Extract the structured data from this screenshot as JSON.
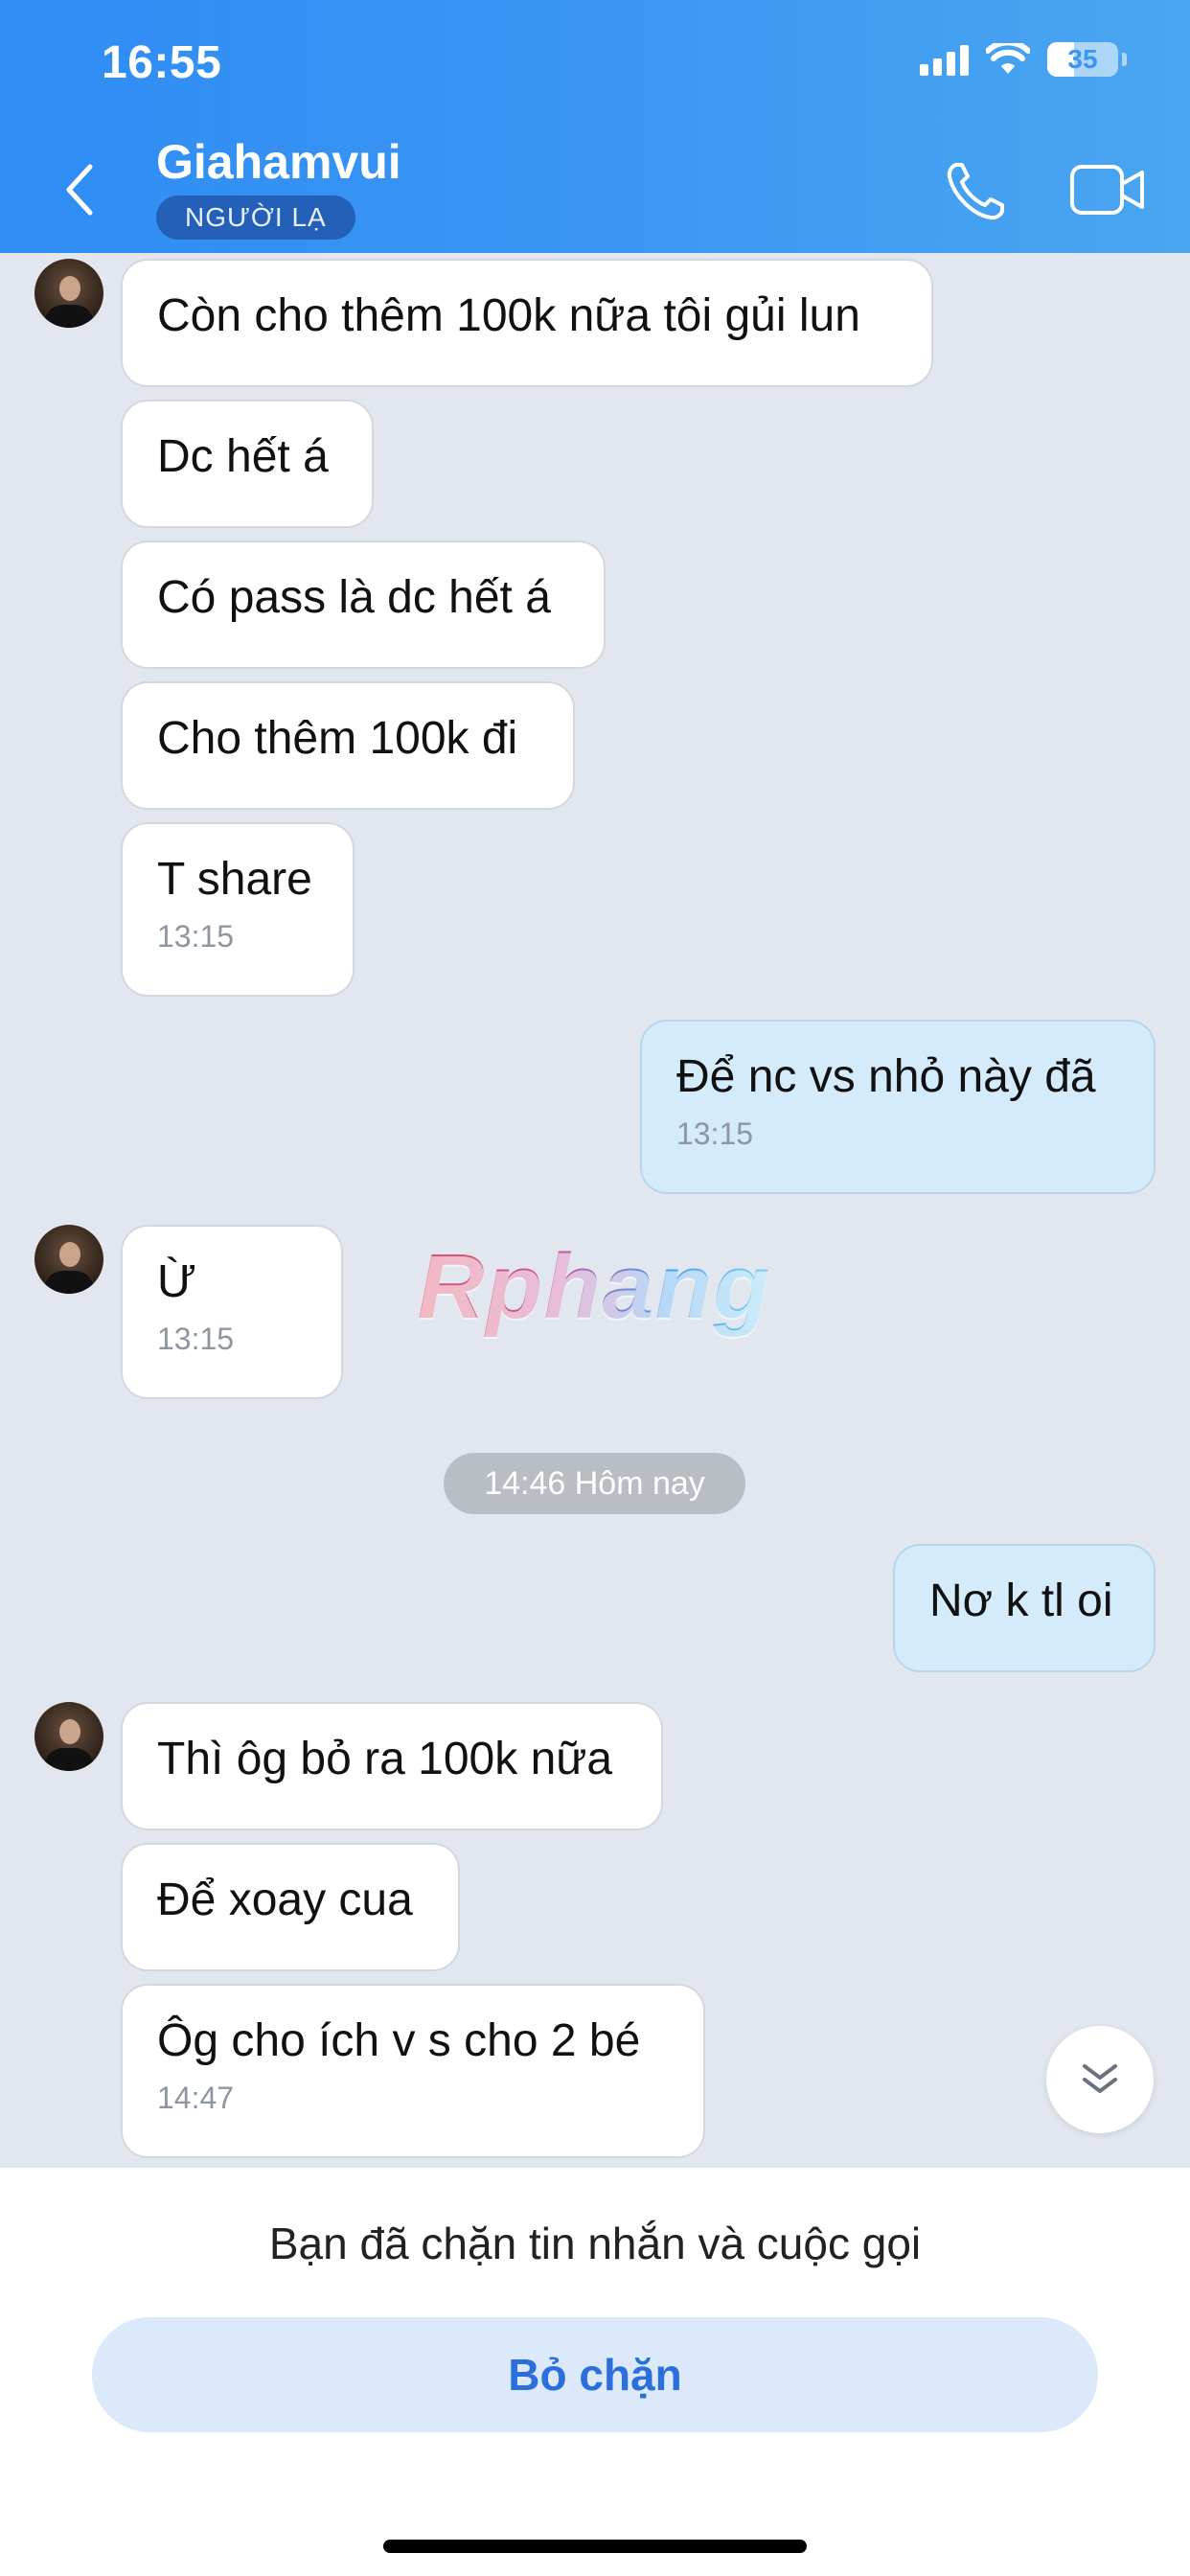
{
  "status_bar": {
    "time": "16:55",
    "battery": "35"
  },
  "header": {
    "contact_name": "Giahamvui",
    "badge": "NGƯỜI LẠ"
  },
  "messages": {
    "m1": {
      "text": "Còn cho thêm 100k nữa tôi gủi lun"
    },
    "m2": {
      "text": "Dc hết á"
    },
    "m3": {
      "text": "Có pass là dc hết á"
    },
    "m4": {
      "text": "Cho thêm 100k đi"
    },
    "m5": {
      "text": "T share",
      "time": "13:15"
    },
    "m6": {
      "text": "Để nc vs nhỏ này đã",
      "time": "13:15"
    },
    "m7": {
      "text": "Ừ",
      "time": "13:15"
    },
    "m8": {
      "text": "Nơ k tl oi"
    },
    "m9": {
      "text": "Thì ôg bỏ ra 100k nữa"
    },
    "m10": {
      "text": "Để xoay cua"
    },
    "m11": {
      "text": "Ôg cho ích v s cho 2 bé",
      "time": "14:47"
    }
  },
  "date_separator": "14:46 Hôm nay",
  "watermark": "Rphang",
  "footer": {
    "blocked_text": "Bạn đã chặn tin nhắn và cuộc gọi",
    "unblock_label": "Bỏ chặn"
  },
  "colors": {
    "header_gradient_start": "#2f8cf4",
    "header_gradient_end": "#4aa6f0",
    "badge_bg": "#2560b8",
    "chat_bg": "#e2e6ee",
    "incoming_bubble": "#ffffff",
    "outgoing_bubble": "#d4ebfc",
    "unblock_button_bg": "#dbe9fb",
    "unblock_button_text": "#2a6fdb"
  },
  "icons": [
    "back-icon",
    "phone-icon",
    "video-camera-icon",
    "wifi-icon",
    "signal-icon",
    "battery-icon",
    "chevron-double-down-icon"
  ]
}
